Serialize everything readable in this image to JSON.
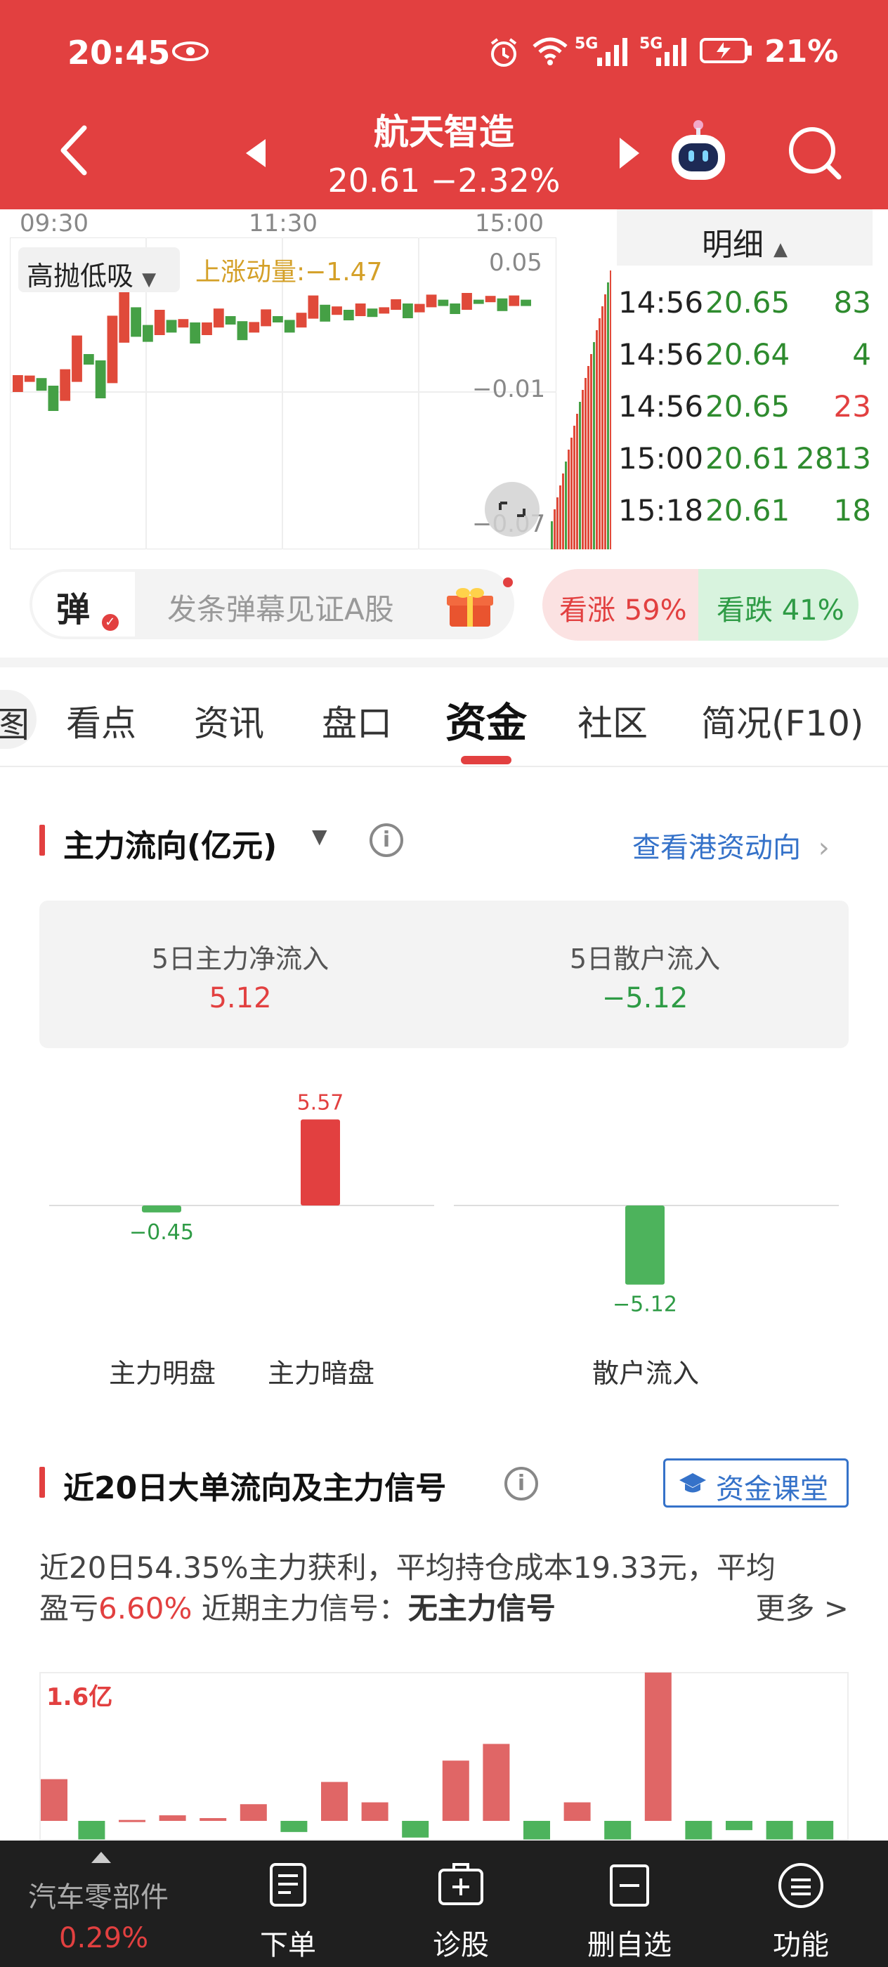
{
  "status_bar": {
    "time": "20:45",
    "battery": "21%",
    "net1": "5G",
    "net2": "5G"
  },
  "stock": {
    "name": "航天智造",
    "price_line": "20.61 −2.32%"
  },
  "intraday": {
    "times": [
      "09:30",
      "11:30",
      "15:00"
    ],
    "strategy": "高抛低吸",
    "momentum": "上涨动量:−1.47",
    "y_top": "0.05",
    "y_mid": "−0.01",
    "y_low": "−0.07"
  },
  "detail": {
    "title": "明细",
    "rows": [
      {
        "time": "14:56",
        "price": "20.65",
        "vol": "83",
        "color": "#2e8b2e"
      },
      {
        "time": "14:56",
        "price": "20.64",
        "vol": "4",
        "color": "#2e8b2e"
      },
      {
        "time": "14:56",
        "price": "20.65",
        "vol": "23",
        "color": "#e24040"
      },
      {
        "time": "15:00",
        "price": "20.61",
        "vol": "2813",
        "color": "#2e8b2e"
      },
      {
        "time": "15:18",
        "price": "20.61",
        "vol": "18",
        "color": "#2e8b2e"
      }
    ]
  },
  "danmu": {
    "badge": "弹",
    "placeholder": "发条弹幕见证A股",
    "bull": "看涨 59%",
    "bear": "看跌 41%"
  },
  "tabs": {
    "prev_stub": "图",
    "items": [
      "看点",
      "资讯",
      "盘口",
      "资金",
      "社区",
      "简况(F10)"
    ],
    "active": "资金"
  },
  "main_flow": {
    "title": "主力流向(亿元)",
    "info": "i",
    "link": "查看港资动向",
    "net5_label": "5日主力净流入",
    "net5_value": "5.12",
    "retail5_label": "5日散户流入",
    "retail5_value": "−5.12"
  },
  "chart_data": [
    {
      "type": "bar",
      "categories": [
        "主力明盘",
        "主力暗盘",
        "散户流入"
      ],
      "values": [
        -0.45,
        5.57,
        -5.12
      ],
      "value_labels": [
        "−0.45",
        "5.57",
        "−5.12"
      ],
      "colors": [
        "#4db35c",
        "#e24040",
        "#4db35c"
      ]
    },
    {
      "type": "bar",
      "y_label_top": "1.6亿",
      "values": [
        0.45,
        -0.2,
        0.01,
        0.06,
        0.03,
        0.18,
        -0.12,
        0.42,
        0.2,
        -0.18,
        0.65,
        0.83,
        -0.2,
        0.2,
        -0.2,
        1.6,
        -0.2,
        -0.1,
        -0.2,
        -0.2
      ],
      "colors_pos": "#e06666",
      "colors_neg": "#4db35c"
    }
  ],
  "bigorder": {
    "title": "近20日大单流向及主力信号",
    "classroom": "资金课堂",
    "line1": "近20日54.35%主力获利，平均持仓成本19.33元，平均",
    "line2_a": "盈亏",
    "line2_b": "6.60%",
    "line2_c": " 近期主力信号：",
    "line2_d": "无主力信号",
    "more": "更多 >"
  },
  "bottom_nav": {
    "sector": "汽车零部件",
    "sector_pct": "0.29%",
    "items": [
      "下单",
      "诊股",
      "删自选",
      "功能"
    ]
  },
  "colors": {
    "brand_red": "#e24040",
    "down_green": "#2e8b2e",
    "link_blue": "#3572c9"
  }
}
